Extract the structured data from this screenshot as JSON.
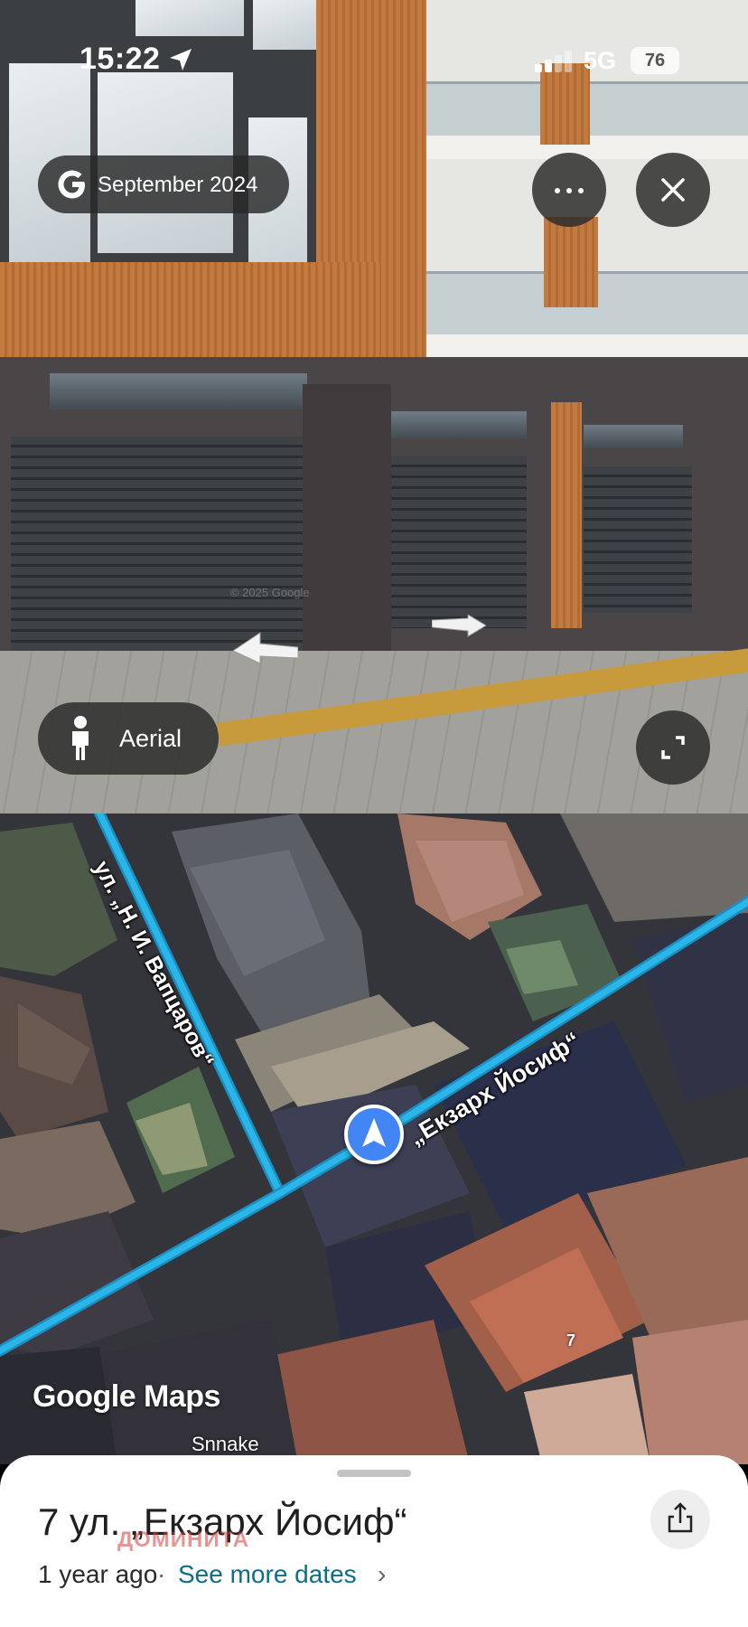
{
  "status_bar": {
    "time": "15:22",
    "network": "5G",
    "battery": "76",
    "icons": [
      "location-arrow-icon",
      "signal-icon"
    ]
  },
  "street_view": {
    "date_label": "September 2024",
    "logo_icon": "google-g-icon",
    "more_icon": "more-horizontal-icon",
    "close_icon": "close-icon",
    "aerial_label": "Aerial",
    "aerial_icon": "pegman-icon",
    "expand_icon": "expand-icon",
    "watermark": "© 2025 Google"
  },
  "map": {
    "streets": [
      "ул. „Н. И. Вапцаров“",
      "„Екзарх Йосиф“"
    ],
    "house_number": "7",
    "poi_label": "Snnake",
    "branding": "Google Maps",
    "marker_icon": "navigation-arrow-icon",
    "road_color": "#2bb6ea"
  },
  "sheet": {
    "title": "7 ул. „Екзарх Йосиф“",
    "watermark": "ДОМИНИТА",
    "age": "1 year ago",
    "separator": "·",
    "see_more": "See more dates",
    "chevron": "›",
    "share_icon": "share-icon"
  }
}
